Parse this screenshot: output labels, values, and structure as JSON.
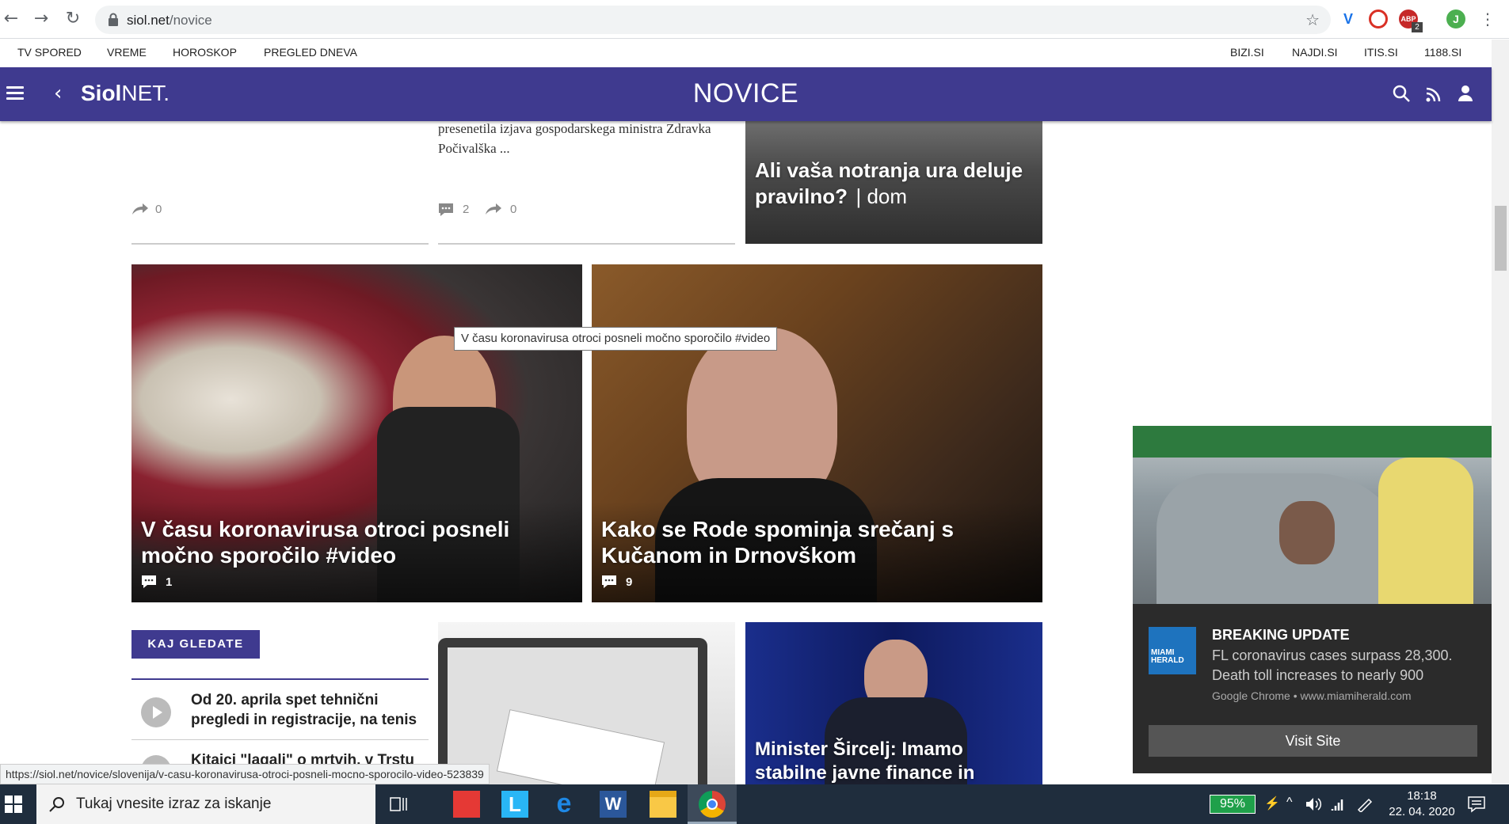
{
  "browser": {
    "url_host": "siol.net",
    "url_path": "/novice",
    "profile_initial": "J",
    "abp_badge": "2"
  },
  "toplinks": {
    "left": [
      "TV SPORED",
      "VREME",
      "HOROSKOP",
      "PREGLED DNEVA"
    ],
    "right": [
      "BIZI.SI",
      "NAJDI.SI",
      "ITIS.SI",
      "1188.SI"
    ]
  },
  "header": {
    "logo_bold": "Siol",
    "logo_rest": "NET.",
    "title": "NOVICE"
  },
  "top_row": {
    "col1_shares": "0",
    "col2_snippet": "presenetila izjava gospodarskega ministra Zdravka Počivalška ...",
    "col2_comments": "2",
    "col2_shares": "0",
    "col3_title": "Ali vaša notranja ura deluje pravilno?",
    "col3_tag": "dom"
  },
  "cards": [
    {
      "title": "V času koronavirusa otroci posneli močno sporočilo #video",
      "comments": "1"
    },
    {
      "title": "Kako se Rode spominja srečanj s Kučanom in Drnovškom",
      "comments": "9"
    }
  ],
  "tooltip": "V času koronavirusa otroci posneli močno sporočilo #video",
  "kaj_gledate": {
    "label": "KAJ GLEDATE",
    "items": [
      "Od 20. aprila spet tehnični pregledi in registracije, na tenis",
      "Kitajci \"lagali\" o mrtvih, v Trstu"
    ]
  },
  "bottom_cards": {
    "card3_title": "Minister Šircelj: Imamo stabilne javne finance in likviden bančni"
  },
  "notification": {
    "title": "BREAKING UPDATE",
    "body": "FL coronavirus cases surpass 28,300. Death toll increases to nearly 900",
    "source": "Google Chrome • www.miamiherald.com",
    "button": "Visit Site",
    "logo_text": "MIAMI HERALD"
  },
  "status_url": "https://siol.net/novice/slovenija/v-casu-koronavirusa-otroci-posneli-mocno-sporocilo-video-523839",
  "taskbar": {
    "search_placeholder": "Tukaj vnesite izraz za iskanje",
    "battery": "95%",
    "time": "18:18",
    "date": "22. 04. 2020"
  }
}
